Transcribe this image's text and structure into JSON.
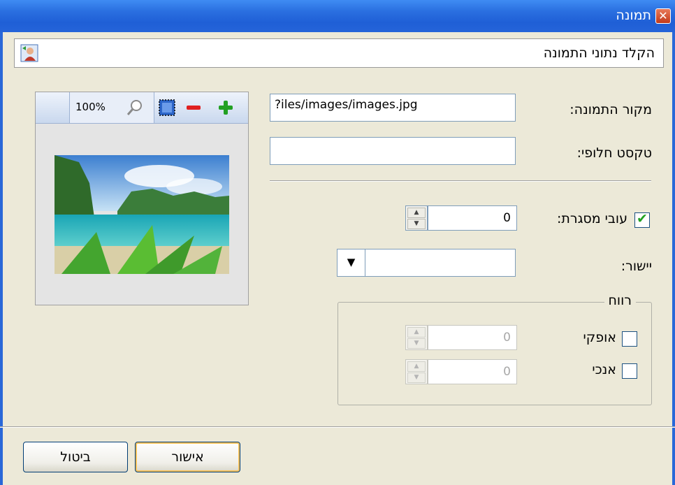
{
  "window": {
    "title": "תמונה",
    "close_glyph": "✕"
  },
  "header": {
    "title": "הקלד נתוני התמונה",
    "icon": "image-user-icon"
  },
  "form": {
    "source_label": "מקור התמונה:",
    "source_value": "?iles/images/images.jpg",
    "alt_label": "טקסט חלופי:",
    "alt_value": "",
    "border_label": "עובי מסגרת:",
    "border_checked": true,
    "border_value": "0",
    "align_label": "יישור:",
    "align_value": "",
    "spacing_legend": "רווח",
    "horizontal_label": "אופקי",
    "horizontal_value": "0",
    "vertical_label": "אנכי",
    "vertical_value": "0"
  },
  "preview": {
    "zoom": "100%",
    "icons": [
      "zoom-in-icon",
      "zoom-out-icon",
      "fit-icon",
      "magnifier-icon"
    ]
  },
  "buttons": {
    "ok": "אישור",
    "cancel": "ביטול"
  },
  "colors": {
    "titlebar": "#2a6fe0",
    "accent_check": "#21a121",
    "dialog_bg": "#ece9d8"
  }
}
